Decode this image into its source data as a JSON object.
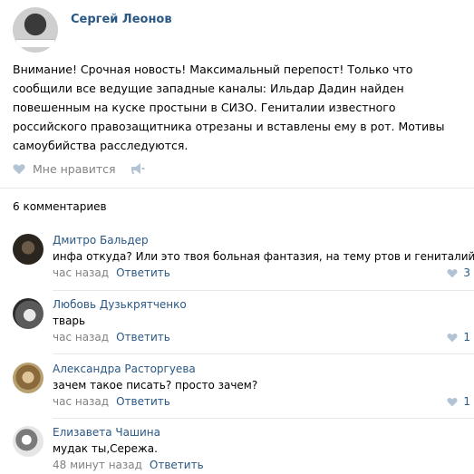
{
  "post": {
    "author": "Сергей Леонов",
    "avatar_caption": "\"Thelma in spite\"",
    "text": "Внимание! Срочная новость! Максимальный перепост! Только что сообщили все ведущие западные каналы: Ильдар Дадин найден повешенным на куске простыни в СИЗО. Гениталии известного российского правозащитника отрезаны и вставлены ему в рот. Мотивы самоубийства расследуются.",
    "like_label": "Мне нравится"
  },
  "comments_count": "6 комментариев",
  "comments": [
    {
      "name": "Дмитро Бальдер",
      "text": "инфа откуда? Или это твоя больная фантазия, на тему ртов и гениталий?",
      "time": "час назад",
      "reply": "Ответить",
      "likes": "3"
    },
    {
      "name": "Любовь Дузькрятченко",
      "text": "тварь",
      "time": "час назад",
      "reply": "Ответить",
      "likes": "1"
    },
    {
      "name": "Александра Расторгуева",
      "text": "зачем такое писать? просто зачем?",
      "time": "час назад",
      "reply": "Ответить",
      "likes": "1"
    },
    {
      "name": "Елизавета Чашина",
      "text": "мудак ты,Сережа.",
      "time": "48 минут назад",
      "reply": "Ответить",
      "likes": ""
    }
  ],
  "colors": {
    "link": "#2a5885",
    "muted": "#828282",
    "icon": "#b2c3d6",
    "divider": "#e7e8ec"
  }
}
